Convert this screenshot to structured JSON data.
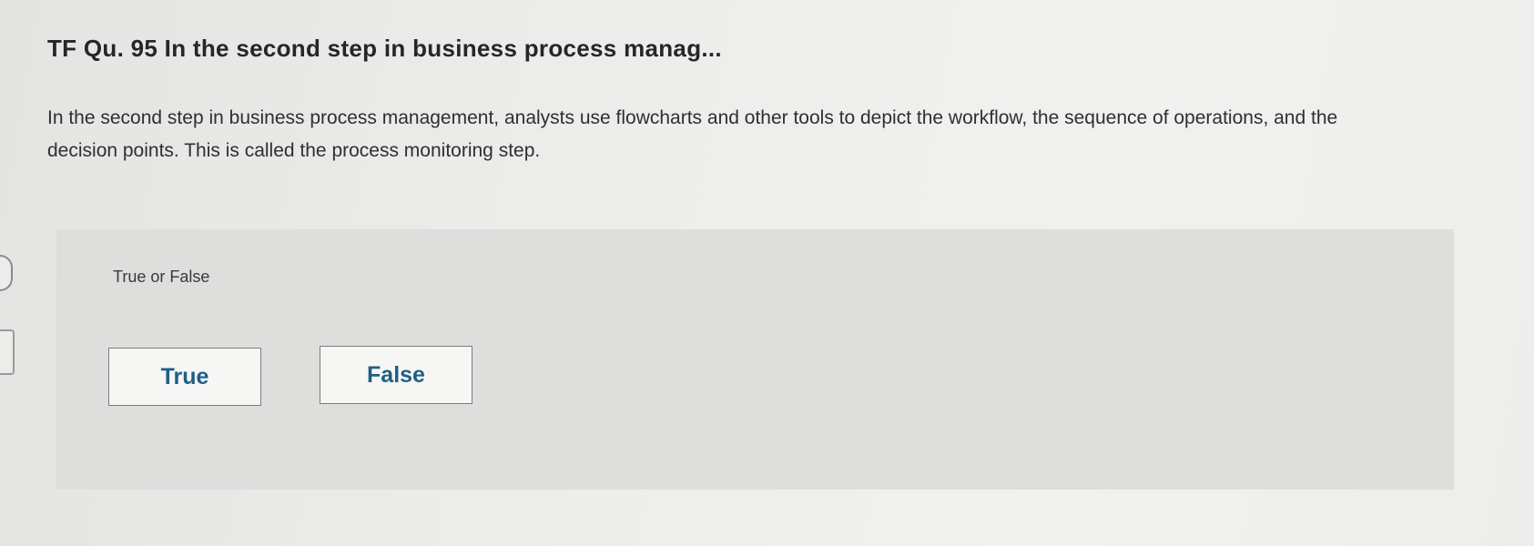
{
  "question": {
    "title": "TF Qu. 95 In the second step in business process manag...",
    "body": "In the second step in business process management, analysts use flowcharts and other tools to depict the workflow, the sequence of operations, and the decision points. This is called the process monitoring step."
  },
  "answer_panel": {
    "prompt": "True or False",
    "choices": [
      {
        "label": "True"
      },
      {
        "label": "False"
      }
    ]
  },
  "colors": {
    "button_text": "#1f5f86",
    "panel_background": "#dededd",
    "page_background": "#ececea"
  }
}
